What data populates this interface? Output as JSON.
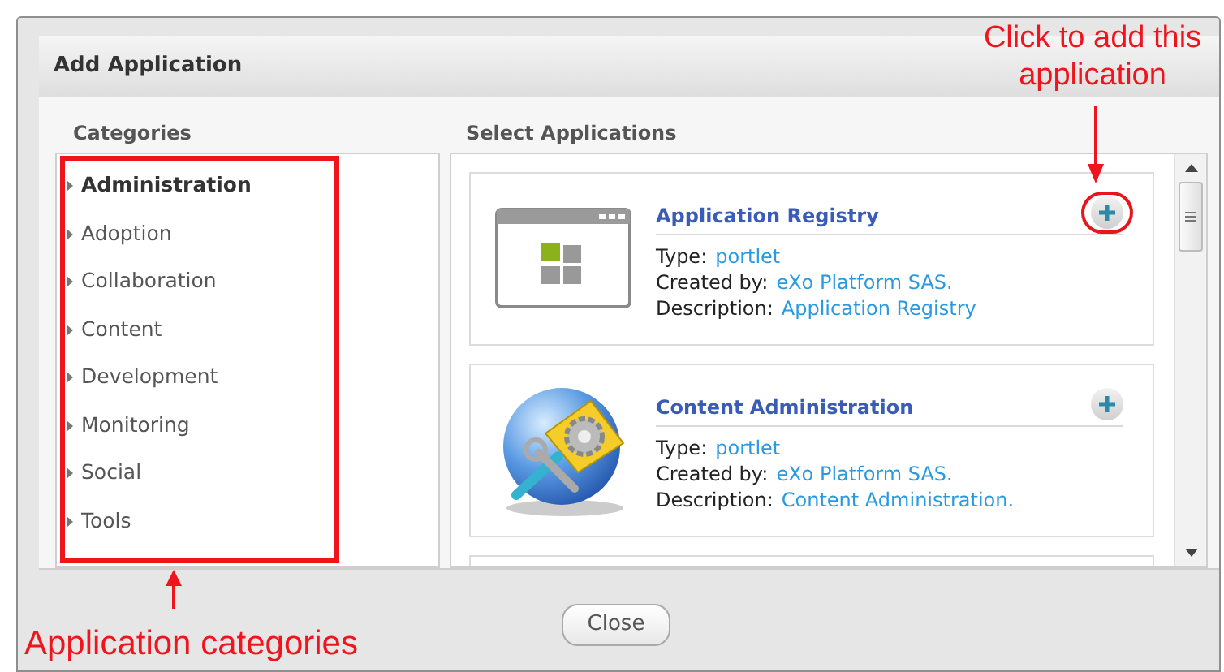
{
  "dialog": {
    "title": "Add Application"
  },
  "categories_heading": "Categories",
  "categories": [
    {
      "label": "Administration",
      "selected": true
    },
    {
      "label": "Adoption",
      "selected": false
    },
    {
      "label": "Collaboration",
      "selected": false
    },
    {
      "label": "Content",
      "selected": false
    },
    {
      "label": "Development",
      "selected": false
    },
    {
      "label": "Monitoring",
      "selected": false
    },
    {
      "label": "Social",
      "selected": false
    },
    {
      "label": "Tools",
      "selected": false
    }
  ],
  "applications_heading": "Select Applications",
  "applications": [
    {
      "kind": "window",
      "title": "Application Registry",
      "type_label": "Type:",
      "type": "portlet",
      "created_by_label": "Created by:",
      "created_by": "eXo Platform SAS.",
      "description_label": "Description:",
      "description": "Application Registry",
      "highlighted": true
    },
    {
      "kind": "globe",
      "title": "Content Administration",
      "type_label": "Type:",
      "type": "portlet",
      "created_by_label": "Created by:",
      "created_by": "eXo Platform SAS.",
      "description_label": "Description:",
      "description": "Content Administration.",
      "highlighted": false
    }
  ],
  "close_button": "Close",
  "annotations": [
    {
      "kind": "top",
      "text": "Click to add this application"
    },
    {
      "kind": "bottom",
      "text": "Application categories"
    }
  ]
}
